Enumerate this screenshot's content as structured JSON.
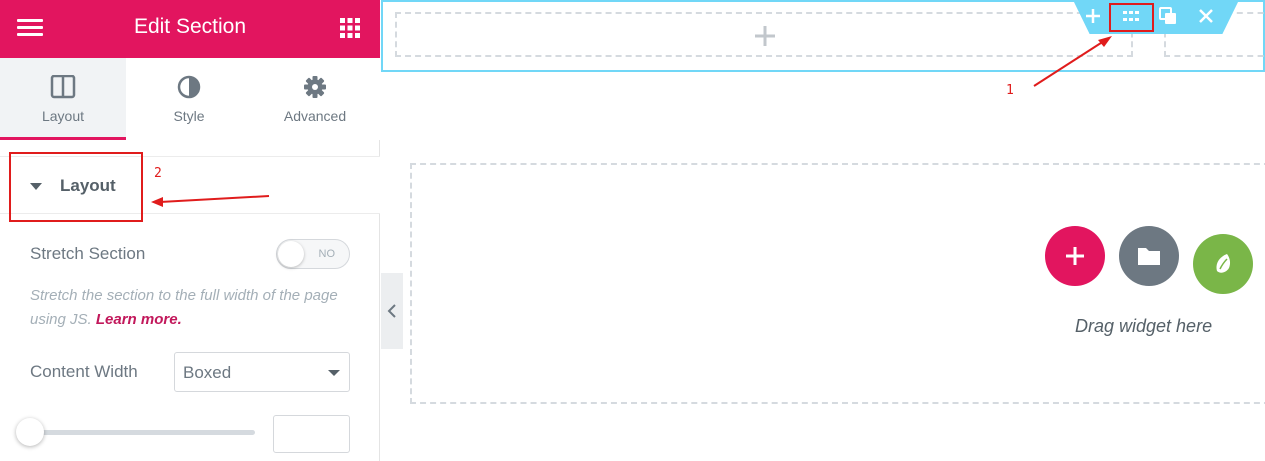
{
  "header": {
    "title": "Edit Section",
    "background": "#e2155f"
  },
  "tabs": [
    {
      "label": "Layout",
      "icon": "columns-icon",
      "active": true
    },
    {
      "label": "Style",
      "icon": "half-circle-icon",
      "active": false
    },
    {
      "label": "Advanced",
      "icon": "gear-icon",
      "active": false
    }
  ],
  "section": {
    "title": "Layout",
    "expanded": true
  },
  "controls": {
    "stretch": {
      "label": "Stretch Section",
      "toggle_text": "NO",
      "value": false
    },
    "stretch_desc": {
      "text": "Stretch the section to the full width of the page using JS.",
      "link": "Learn more."
    },
    "content_width": {
      "label": "Content Width",
      "value": "Boxed"
    },
    "width_slider": {
      "value": 0,
      "input_value": ""
    }
  },
  "canvas": {
    "drag_text": "Drag widget here",
    "section_toolbar": [
      "add-icon",
      "drag-handle-icon",
      "duplicate-icon",
      "close-icon"
    ],
    "accent": "#71d7f7"
  },
  "annotations": {
    "one": "1",
    "two": "2",
    "color": "#e01c1c"
  },
  "colors": {
    "pink": "#e2155f",
    "gray": "#6d7882",
    "green": "#7ab648"
  }
}
